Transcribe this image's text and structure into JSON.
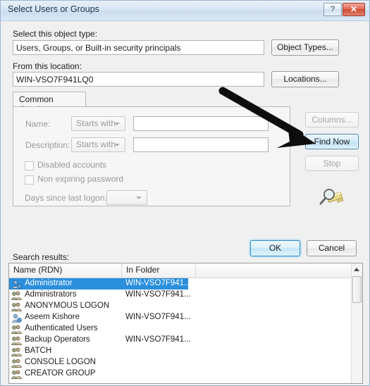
{
  "window": {
    "title": "Select Users or Groups",
    "help_label": "?",
    "close_label": "✕"
  },
  "object_type": {
    "label": "Select this object type:",
    "value": "Users, Groups, or Built-in security principals",
    "button_label": "Object Types..."
  },
  "location": {
    "label": "From this location:",
    "value": "WIN-VSO7F941LQ0",
    "button_label": "Locations..."
  },
  "queries": {
    "tab_label": "Common Queries",
    "name_label": "Name:",
    "name_operator": "Starts with",
    "name_value": "",
    "description_label": "Description:",
    "description_operator": "Starts with",
    "description_value": "",
    "disabled_accounts_label": "Disabled accounts",
    "non_expiring_password_label": "Non expiring password",
    "days_label": "Days since last logon:",
    "days_value": ""
  },
  "side_buttons": {
    "columns_label": "Columns...",
    "find_now_label": "Find Now",
    "stop_label": "Stop",
    "find_icon": "magnifier-keys-icon"
  },
  "footer": {
    "ok_label": "OK",
    "cancel_label": "Cancel"
  },
  "results": {
    "label": "Search results:",
    "columns": [
      "Name (RDN)",
      "In Folder"
    ],
    "rows": [
      {
        "name": "Administrator",
        "folder": "WIN-VSO7F941...",
        "icon": "user-icon",
        "selected": true
      },
      {
        "name": "Administrators",
        "folder": "WIN-VSO7F941...",
        "icon": "group-icon",
        "selected": false
      },
      {
        "name": "ANONYMOUS LOGON",
        "folder": "",
        "icon": "group-icon",
        "selected": false
      },
      {
        "name": "Aseem Kishore",
        "folder": "WIN-VSO7F941...",
        "icon": "user-icon",
        "selected": false
      },
      {
        "name": "Authenticated Users",
        "folder": "",
        "icon": "group-icon",
        "selected": false
      },
      {
        "name": "Backup Operators",
        "folder": "WIN-VSO7F941...",
        "icon": "group-icon",
        "selected": false
      },
      {
        "name": "BATCH",
        "folder": "",
        "icon": "group-icon",
        "selected": false
      },
      {
        "name": "CONSOLE LOGON",
        "folder": "",
        "icon": "group-icon",
        "selected": false
      },
      {
        "name": "CREATOR GROUP",
        "folder": "",
        "icon": "group-icon",
        "selected": false
      }
    ]
  },
  "annotation": {
    "arrow": "arrow-pointing-to-find-now",
    "color": "#0d0d0d"
  },
  "colors": {
    "selection": "#2a8fdd",
    "title_text": "#17334d",
    "close_red": "#cf4b34"
  }
}
